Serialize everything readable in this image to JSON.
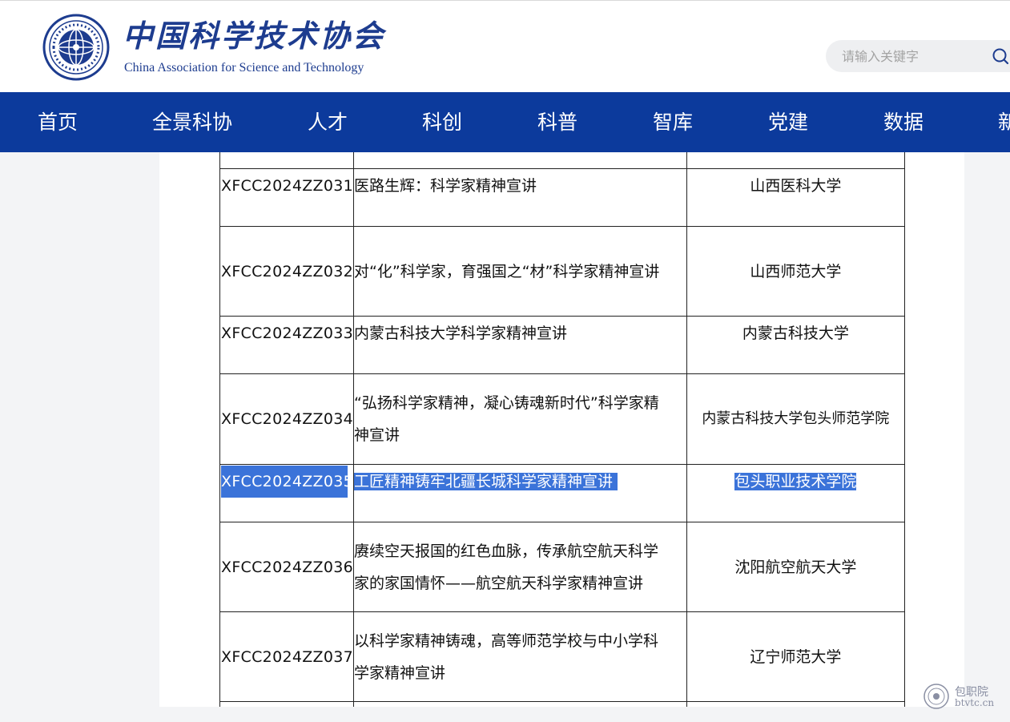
{
  "header": {
    "logo_cn": "中国科学技术协会",
    "logo_en": "China Association for Science and Technology",
    "search_placeholder": "请输入关键字"
  },
  "nav": {
    "items": [
      "首页",
      "全景科协",
      "人才",
      "科创",
      "科普",
      "智库",
      "党建",
      "数据",
      "新"
    ]
  },
  "table": {
    "rows": [
      {
        "code": "XFCC2024ZZ031",
        "title": "医路生辉：科学家精神宣讲",
        "org": "山西医科大学",
        "selected": false
      },
      {
        "code": "XFCC2024ZZ032",
        "title": "对“化”科学家，育强国之“材”科学家精神宣讲",
        "org": "山西师范大学",
        "selected": false
      },
      {
        "code": "XFCC2024ZZ033",
        "title": "内蒙古科技大学科学家精神宣讲",
        "org": "内蒙古科技大学",
        "selected": false
      },
      {
        "code": "XFCC2024ZZ034",
        "title": "“弘扬科学家精神，凝心铸魂新时代”科学家精神宣讲",
        "org": "内蒙古科技大学包头师范学院",
        "selected": false
      },
      {
        "code": "XFCC2024ZZ035",
        "title": "工匠精神铸牢北疆长城科学家精神宣讲",
        "org": "包头职业技术学院",
        "selected": true
      },
      {
        "code": "XFCC2024ZZ036",
        "title": "赓续空天报国的红色血脉，传承航空航天科学家的家国情怀——航空航天科学家精神宣讲",
        "org": "沈阳航空航天大学",
        "selected": false
      },
      {
        "code": "XFCC2024ZZ037",
        "title": "以科学家精神铸魂，高等师范学校与中小学科学家精神宣讲",
        "org": "辽宁师范大学",
        "selected": false
      }
    ]
  },
  "watermark": {
    "line1": "包职院",
    "line2": "btvtc.cn"
  },
  "colors": {
    "nav_bg": "#0c3a9c",
    "brand": "#1d3c8f",
    "selection": "#3b73d9"
  }
}
